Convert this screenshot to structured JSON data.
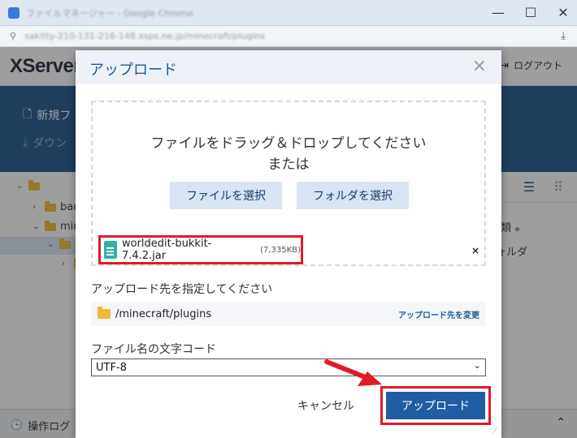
{
  "browser": {
    "title": "ファイルマネージャー - Google Chrome",
    "url": "sakitty-210-131-216-148.xsps.ne.jp/minecraft/plugins",
    "buttons": {
      "minimize": "—",
      "maximize": "☐",
      "close": "✕"
    },
    "download_icon": "download-icon"
  },
  "app": {
    "brand": "XServer",
    "logout": "ログアウト",
    "toolbar": {
      "new_prefix": "新規フ",
      "download_prefix": "ダウン"
    },
    "tree": [
      {
        "label": "",
        "level": 0
      },
      {
        "label": "bac",
        "level": 1
      },
      {
        "label": "min",
        "level": 1
      },
      {
        "label": "",
        "level": 2
      },
      {
        "label": "",
        "level": 3
      }
    ],
    "kind_header": "類",
    "kind_value": "ォルダ",
    "footer": {
      "op_log": "操作ログ"
    }
  },
  "modal": {
    "title": "アップロード",
    "close": "×",
    "dropzone": {
      "line1": "ファイルをドラッグ＆ドロップしてください",
      "line2": "または",
      "select_file": "ファイルを選択",
      "select_folder": "フォルダを選択"
    },
    "file": {
      "name": "worldedit-bukkit-7.4.2.jar",
      "size": "(7,335KB)",
      "remove": "×"
    },
    "destination": {
      "label": "アップロード先を指定してください",
      "path": "/minecraft/plugins",
      "change": "アップロード先を変更"
    },
    "encoding": {
      "label": "ファイル名の文字コード",
      "value": "UTF-8"
    },
    "cancel": "キャンセル",
    "upload": "アップロード"
  },
  "colors": {
    "accent": "#1f5ea3",
    "highlight": "#e01b24",
    "toolbar": "#1a4f86"
  }
}
